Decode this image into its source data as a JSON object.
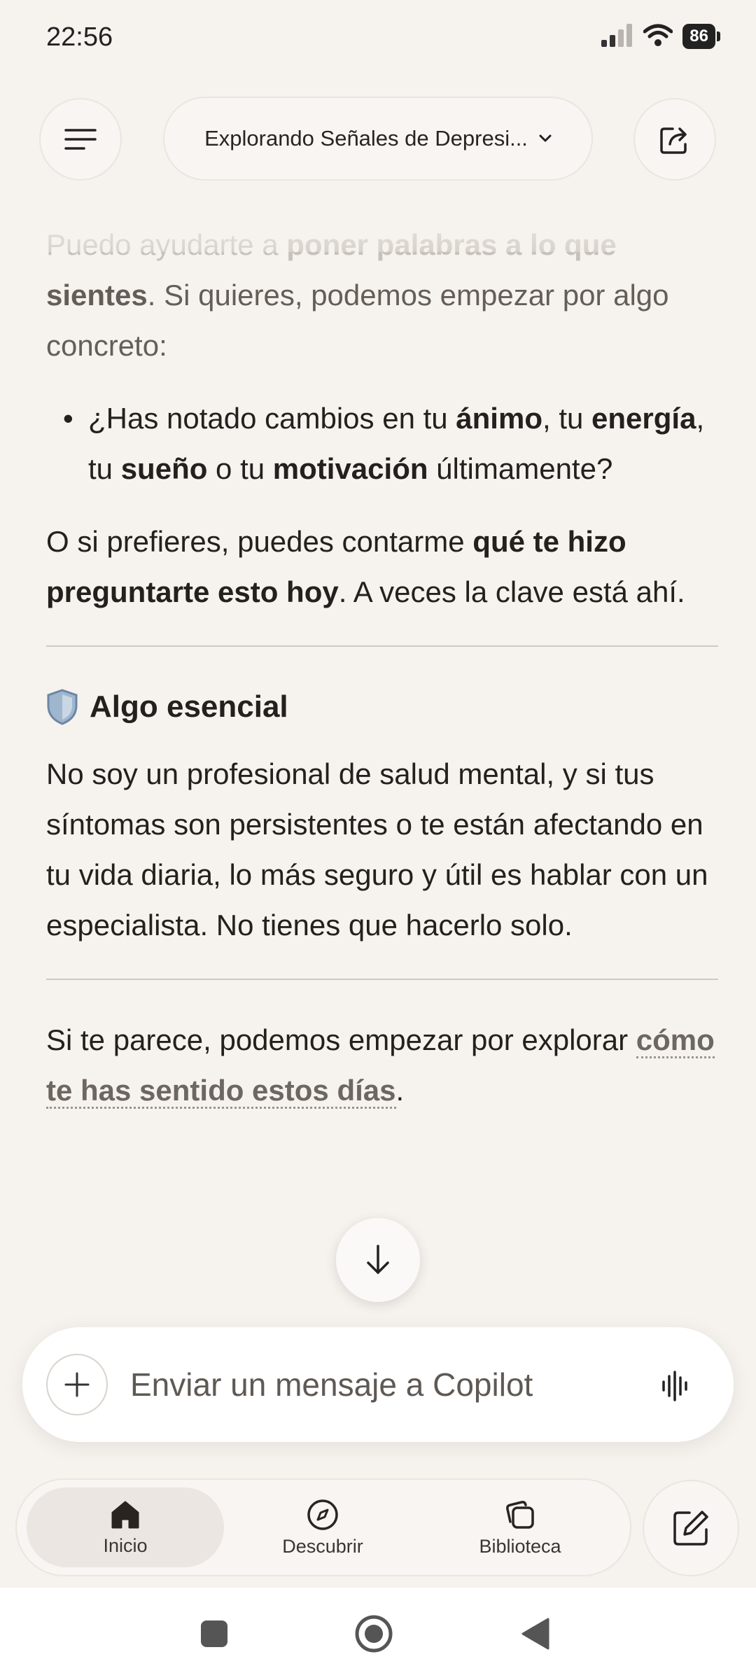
{
  "status_bar": {
    "time": "22:56",
    "battery": "86"
  },
  "header": {
    "conversation_title": "Explorando Señales de Depresi..."
  },
  "message": {
    "intro_faded_prefix": "Puedo ayudarte a ",
    "intro_faded_bold": "poner palabras a lo que",
    "intro_bold": "sientes",
    "intro_rest": ". Si quieres, podemos empezar por algo concreto:",
    "bullet": {
      "p1": "¿Has notado cambios en tu ",
      "b1": "ánimo",
      "p2": ", tu ",
      "b2": "energía",
      "p3": ", tu ",
      "b3": "sueño",
      "p4": " o tu ",
      "b4": "motivación",
      "p5": " últimamente?"
    },
    "para2": {
      "p1": "O si prefieres, puedes contarme ",
      "b1": "qué te hizo preguntarte esto hoy",
      "p2": ". A veces la clave está ahí."
    },
    "section_title": "Algo esencial",
    "section_body": "No soy un profesional de salud mental, y si tus síntomas son persistentes o te están afectando en tu vida diaria, lo más seguro y útil es hablar con un especialista. No tienes que hacerlo solo.",
    "closing": {
      "p1": "Si te parece, podemos empezar por explorar ",
      "link": "cómo te has sentido estos días",
      "p2": "."
    }
  },
  "composer": {
    "placeholder": "Enviar un mensaje a Copilot"
  },
  "bottom_nav": [
    {
      "label": "Inicio",
      "active": true
    },
    {
      "label": "Descubrir",
      "active": false
    },
    {
      "label": "Biblioteca",
      "active": false
    }
  ],
  "colors": {
    "background": "#f6f2ee",
    "text": "#24201d",
    "muted": "#6d6661",
    "shield": "#8aa4c0"
  }
}
